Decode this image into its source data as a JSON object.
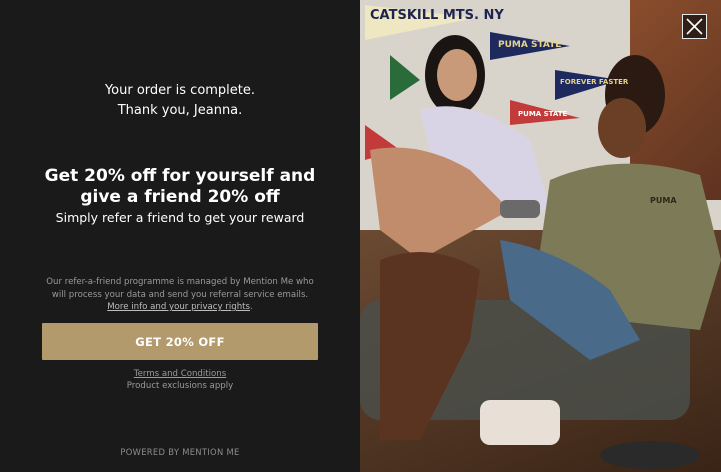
{
  "confirmation": {
    "line1": "Your order is complete.",
    "line2": "Thank you, Jeanna."
  },
  "offer": {
    "headline": "Get 20% off for yourself and give a friend 20% off",
    "subline": "Simply refer a friend to get your reward"
  },
  "legal": {
    "text": "Our refer-a-friend programme is managed by Mention Me who will process your data and send you referral service emails.",
    "link": "More info and your privacy rights",
    "period": "."
  },
  "cta": {
    "label": "GET 20% OFF"
  },
  "terms": {
    "link": "Terms and Conditions",
    "exclusions": "Product exclusions apply"
  },
  "footer": {
    "powered_by": "POWERED BY MENTION ME"
  },
  "photo": {
    "pennants": [
      "CATSKILL MTS. NY",
      "PUMA STATE",
      "FOREVER FASTER",
      "PUMA STATE"
    ],
    "shirt_logo": "PUMA"
  },
  "colors": {
    "panel": "#1b1a1a",
    "cta": "#b39a6c",
    "muted_text": "#9a9a9a"
  },
  "icons": {
    "close": "close-icon"
  }
}
